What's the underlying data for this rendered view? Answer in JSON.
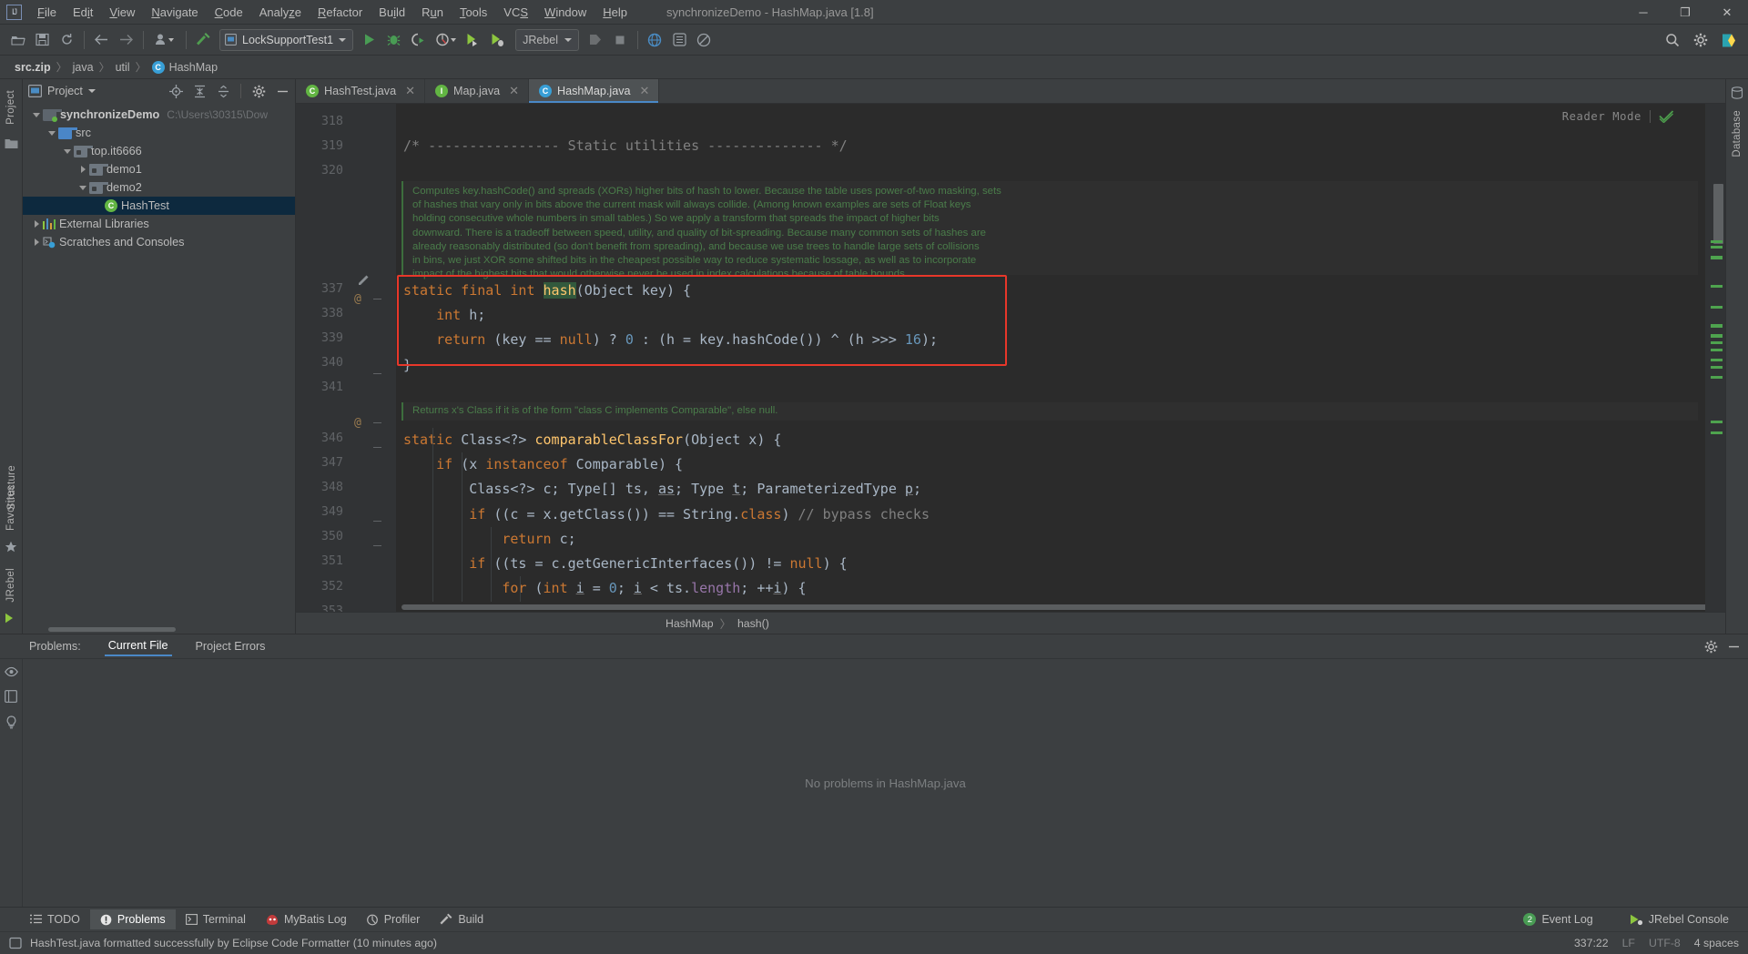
{
  "window": {
    "title": "synchronizeDemo - HashMap.java [1.8]",
    "controls": {
      "minimize": "─",
      "maximize": "❐",
      "close": "✕"
    }
  },
  "menu": {
    "items": [
      "File",
      "Edit",
      "View",
      "Navigate",
      "Code",
      "Analyze",
      "Refactor",
      "Build",
      "Run",
      "Tools",
      "VCS",
      "Window",
      "Help"
    ]
  },
  "toolbar": {
    "run_config": "LockSupportTest1",
    "jrebel": "JRebel",
    "icons": [
      "open-folder-icon",
      "save-all-icon",
      "sync-icon",
      "back-icon",
      "forward-icon",
      "profile-icon",
      "build-hammer-icon",
      "run-icon",
      "debug-icon",
      "run-coverage-icon",
      "profiler-run-icon",
      "jrebel-run-icon",
      "jrebel-debug-icon",
      "stop-icon",
      "update-app-icon",
      "settings-icon",
      "browser-icon",
      "search-everywhere-icon",
      "structure-icon",
      "no-entry-icon"
    ],
    "right_icons": [
      "search-icon",
      "gear-icon",
      "ide-logo-icon"
    ]
  },
  "breadcrumb": {
    "segments": [
      "src.zip",
      "java",
      "util",
      "HashMap"
    ],
    "separator": "〉"
  },
  "sidebar": {
    "left_rail": [
      "Project",
      "Structure",
      "Favorites",
      "JRebel"
    ],
    "right_rail": [
      "Database"
    ],
    "panel_title": "Project",
    "panel_icons": [
      "locate-icon",
      "expand-all-icon",
      "collapse-all-icon",
      "gear-icon",
      "hide-icon"
    ],
    "tree": [
      {
        "label": "synchronizeDemo",
        "path": "C:\\Users\\30315\\Dow",
        "depth": 0,
        "arrow": "down",
        "icon": "module-folder-icon",
        "bold": true,
        "selected": false
      },
      {
        "label": "src",
        "path": "",
        "depth": 1,
        "arrow": "down",
        "icon": "source-folder-icon",
        "bold": false,
        "selected": false
      },
      {
        "label": "top.it6666",
        "path": "",
        "depth": 2,
        "arrow": "down",
        "icon": "package-icon",
        "bold": false,
        "selected": false
      },
      {
        "label": "demo1",
        "path": "",
        "depth": 3,
        "arrow": "right",
        "icon": "package-icon",
        "bold": false,
        "selected": false
      },
      {
        "label": "demo2",
        "path": "",
        "depth": 3,
        "arrow": "down",
        "icon": "package-icon",
        "bold": false,
        "selected": false
      },
      {
        "label": "HashTest",
        "path": "",
        "depth": 4,
        "arrow": "none",
        "icon": "runnable-class-icon",
        "bold": false,
        "selected": true
      },
      {
        "label": "External Libraries",
        "path": "",
        "depth": 0,
        "arrow": "right",
        "icon": "libraries-icon",
        "bold": false,
        "selected": false
      },
      {
        "label": "Scratches and Consoles",
        "path": "",
        "depth": 0,
        "arrow": "right",
        "icon": "scratches-icon",
        "bold": false,
        "selected": false
      }
    ]
  },
  "editor": {
    "tabs": [
      {
        "label": "HashTest.java",
        "icon": "runnable-class-icon",
        "active": false
      },
      {
        "label": "Map.java",
        "icon": "interface-locked-icon",
        "active": false
      },
      {
        "label": "HashMap.java",
        "icon": "class-locked-icon",
        "active": true
      }
    ],
    "reader_mode": "Reader Mode",
    "line_numbers": [
      "318",
      "319",
      "320",
      "",
      "",
      "",
      "",
      "",
      "337",
      "338",
      "339",
      "340",
      "341",
      "",
      "",
      "346",
      "347",
      "348",
      "349",
      "350",
      "351",
      "352",
      "353"
    ],
    "javadoc_1": "Computes key.hashCode() and spreads (XORs) higher bits of hash to lower. Because the table uses power-of-two masking, sets\nof hashes that vary only in bits above the current mask will always collide. (Among known examples are sets of Float keys\nholding consecutive whole numbers in small tables.) So we apply a transform that spreads the impact of higher bits\ndownward. There is a tradeoff between speed, utility, and quality of bit-spreading. Because many common sets of hashes are\nalready reasonably distributed (so don't benefit from spreading), and because we use trees to handle large sets of collisions\nin bins, we just XOR some shifted bits in the cheapest possible way to reduce systematic lossage, as well as to incorporate\nimpact of the highest bits that would otherwise never be used in index calculations because of table bounds.",
    "javadoc_2": "Returns x's Class if it is of the form \"class C implements Comparable\", else null.",
    "comment_static_utilities": "/* ---------------- Static utilities -------------- */",
    "code_lines": [
      "static final int hash(Object key) {",
      "    int h;",
      "    return (key == null) ? 0 : (h = key.hashCode()) ^ (h >>> 16);",
      "}",
      "static Class<?> comparableClassFor(Object x) {",
      "    if (x instanceof Comparable) {",
      "        Class<?> c; Type[] ts, as; Type t; ParameterizedType p;",
      "        if ((c = x.getClass()) == String.class) // bypass checks",
      "            return c;",
      "        if ((ts = c.getGenericInterfaces()) != null) {",
      "            for (int i = 0; i < ts.length; ++i) {",
      "                if (((t = ts[i]) instanceof ParameterizedType) &&"
    ],
    "breadcrumb_bottom": {
      "class": "HashMap",
      "method": "hash()",
      "separator": "〉"
    },
    "highlight_color": "#e8372a"
  },
  "problems": {
    "label": "Problems:",
    "tabs": [
      {
        "label": "Current File",
        "active": true
      },
      {
        "label": "Project Errors",
        "active": false
      }
    ],
    "empty_message": "No problems in HashMap.java",
    "rail_icons": [
      "eye-icon",
      "panel-icon",
      "lightbulb-icon"
    ],
    "header_icons": [
      "gear-icon",
      "hide-icon"
    ]
  },
  "toolwindow_bar": {
    "items": [
      {
        "label": "TODO",
        "icon": "todo-icon",
        "active": false
      },
      {
        "label": "Problems",
        "icon": "problems-icon",
        "active": true
      },
      {
        "label": "Terminal",
        "icon": "terminal-icon",
        "active": false
      },
      {
        "label": "MyBatis Log",
        "icon": "mybatis-icon",
        "active": false
      },
      {
        "label": "Profiler",
        "icon": "profiler-icon",
        "active": false
      },
      {
        "label": "Build",
        "icon": "build-hammer-icon",
        "active": false
      }
    ],
    "right": [
      {
        "label": "Event Log",
        "badge": "2",
        "icon": "event-log-icon"
      },
      {
        "label": "JRebel Console",
        "badge": "",
        "icon": "jrebel-icon"
      }
    ]
  },
  "statusbar": {
    "message": "HashTest.java formatted successfully by Eclipse Code Formatter (10 minutes ago)",
    "caret": "337:22",
    "line_sep": "LF",
    "encoding": "UTF-8",
    "indent": "4 spaces"
  }
}
